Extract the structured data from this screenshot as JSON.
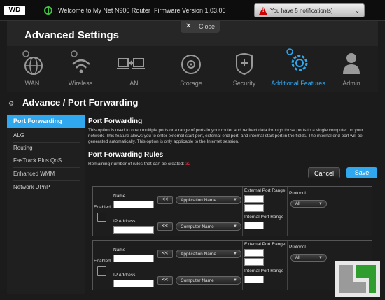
{
  "topbar": {
    "logo": "WD",
    "welcome": "Welcome to My Net N900 Router",
    "firmware": "Firmware Version 1.03.06",
    "notification": "You have 5 notification(s)"
  },
  "header": {
    "title": "Advanced Settings",
    "close_label": "Close"
  },
  "nav": [
    {
      "label": "WAN",
      "icon": "globe-icon"
    },
    {
      "label": "Wireless",
      "icon": "wifi-icon"
    },
    {
      "label": "LAN",
      "icon": "lan-icon"
    },
    {
      "label": "Storage",
      "icon": "storage-icon"
    },
    {
      "label": "Security",
      "icon": "shield-icon"
    },
    {
      "label": "Additional Features",
      "icon": "gear-icon",
      "active": true
    },
    {
      "label": "Admin",
      "icon": "user-icon"
    }
  ],
  "section": {
    "title": "Advance / Port Forwarding"
  },
  "sidebar": {
    "items": [
      {
        "label": "Port Forwarding",
        "active": true
      },
      {
        "label": "ALG"
      },
      {
        "label": "Routing"
      },
      {
        "label": "FasTrack Plus QoS"
      },
      {
        "label": "Enhanced WMM"
      },
      {
        "label": "Network UPnP"
      }
    ]
  },
  "main": {
    "title": "Port Forwarding",
    "description": "This option is used to open multiple ports or a range of ports in your router and redirect data through those ports to a single computer on your network. This feature allows you to enter external start port, external end port, and internal start port in the fields. The internal end port will be generated automatically. This option is only applicable to the Internet session.",
    "rules_title": "Port Forwarding Rules",
    "remaining_label": "Remaining number of rules that can be created:",
    "remaining_count": "32",
    "cancel_label": "Cancel",
    "save_label": "Save"
  },
  "rules": [
    {
      "enabled_label": "Enabled",
      "name_label": "Name",
      "ip_label": "IP Address",
      "arrow_label": "<<",
      "app_select": "Application Name",
      "computer_select": "Computer Name",
      "ext_range_label": "External Port Range",
      "int_range_label": "Internal Port Range",
      "protocol_label": "Protocol",
      "protocol_value": "All"
    },
    {
      "enabled_label": "Enabled",
      "name_label": "Name",
      "ip_label": "IP Address",
      "arrow_label": "<<",
      "app_select": "Application Name",
      "computer_select": "Computer Name",
      "ext_range_label": "External Port Range",
      "int_range_label": "Internal Port Range",
      "protocol_label": "Protocol",
      "protocol_value": "All"
    }
  ],
  "colors": {
    "accent": "#2fa8ef",
    "background": "#1b1b1b",
    "count_red": "#e34444"
  }
}
